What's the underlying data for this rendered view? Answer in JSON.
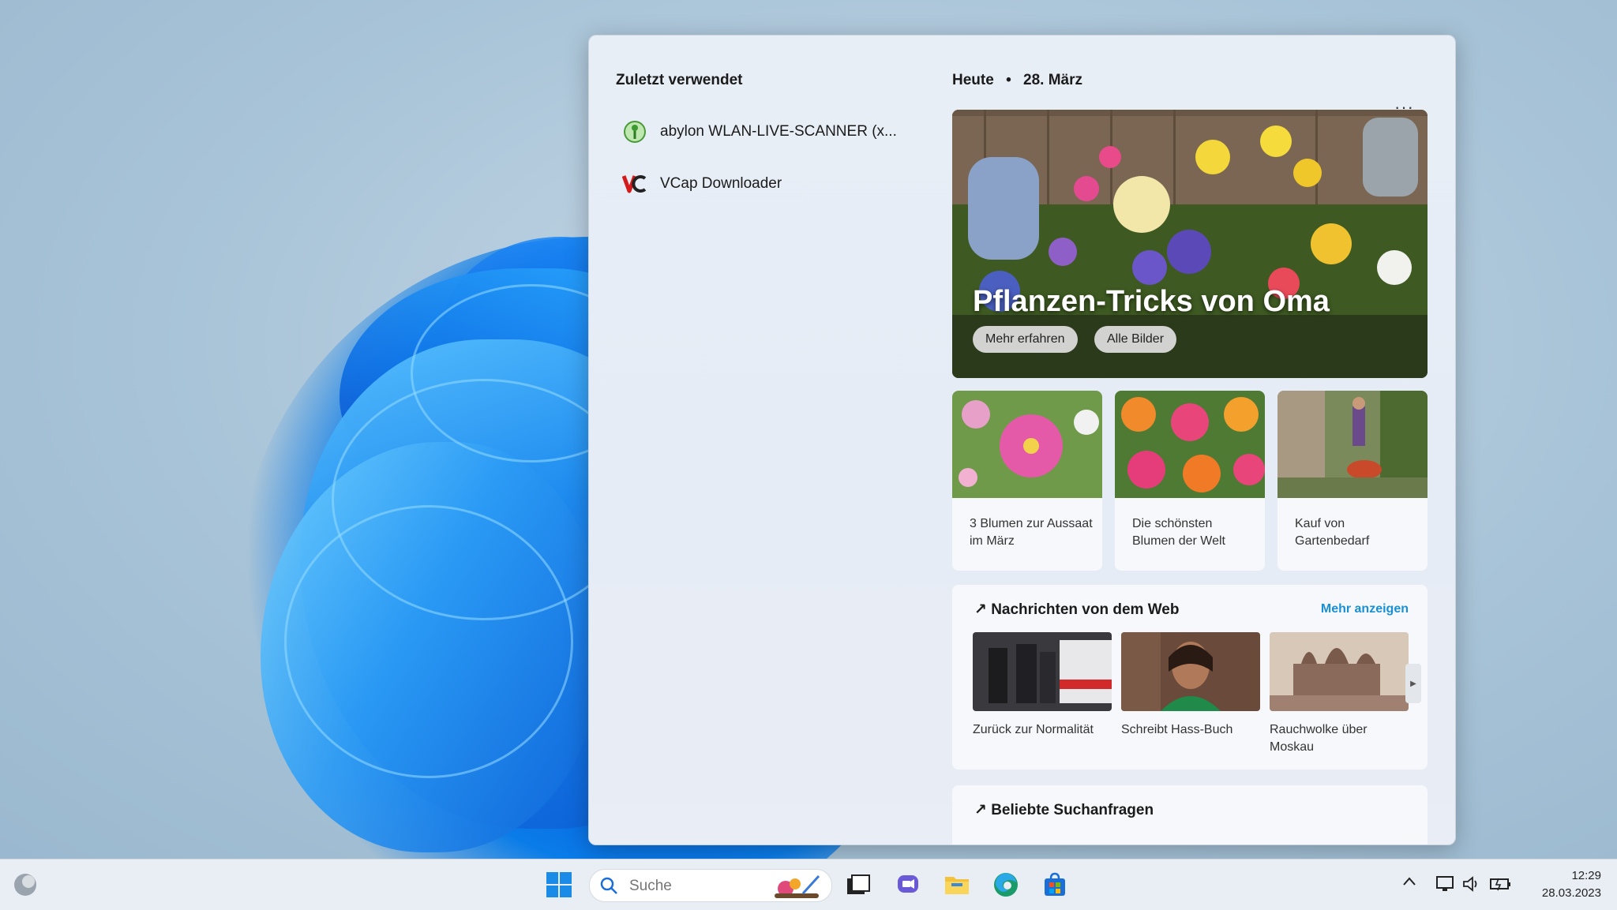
{
  "recent": {
    "title": "Zuletzt verwendet",
    "items": [
      {
        "label": "abylon WLAN-LIVE-SCANNER (x...",
        "icon": "wlan-scanner-icon"
      },
      {
        "label": "VCap Downloader",
        "icon": "vcap-icon"
      }
    ]
  },
  "today": {
    "title": "Heute",
    "separator": "•",
    "date": "28. März",
    "more_label": "···"
  },
  "hero": {
    "title": "Pflanzen-Tricks von Oma",
    "buttons": [
      "Mehr erfahren",
      "Alle Bilder"
    ]
  },
  "cards": [
    {
      "text": "3 Blumen zur Aussaat im März"
    },
    {
      "text": "Die schönsten Blumen der Welt"
    },
    {
      "text": "Kauf von Gartenbedarf"
    }
  ],
  "news": {
    "title": "Nachrichten von dem Web",
    "more": "Mehr anzeigen",
    "items": [
      {
        "caption": "Zurück zur Normalität"
      },
      {
        "caption": "Schreibt Hass-Buch"
      },
      {
        "caption": "Rauchwolke über Moskau"
      }
    ]
  },
  "popular": {
    "title": "Beliebte Suchanfragen"
  },
  "taskbar": {
    "search_placeholder": "Suche",
    "time": "12:29",
    "date": "28.03.2023"
  },
  "colors": {
    "accent": "#1a8fd6",
    "start_blue": "#0078d4"
  }
}
